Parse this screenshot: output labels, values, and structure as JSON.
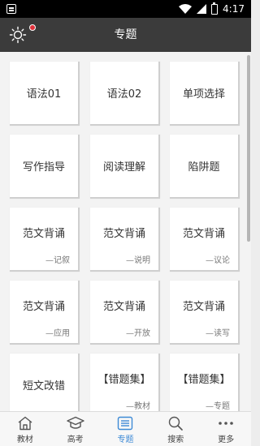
{
  "status_bar": {
    "time": "4:17"
  },
  "app_bar": {
    "title": "专题"
  },
  "cards": [
    {
      "label": "语法01",
      "sub": ""
    },
    {
      "label": "语法02",
      "sub": ""
    },
    {
      "label": "单项选择",
      "sub": ""
    },
    {
      "label": "写作指导",
      "sub": ""
    },
    {
      "label": "阅读理解",
      "sub": ""
    },
    {
      "label": "陷阱题",
      "sub": ""
    },
    {
      "label": "范文背诵",
      "sub": "—记叙"
    },
    {
      "label": "范文背诵",
      "sub": "—说明"
    },
    {
      "label": "范文背诵",
      "sub": "—议论"
    },
    {
      "label": "范文背诵",
      "sub": "—应用"
    },
    {
      "label": "范文背诵",
      "sub": "—开放"
    },
    {
      "label": "范文背诵",
      "sub": "—读写"
    },
    {
      "label": "短文改错",
      "sub": ""
    },
    {
      "label": "【错题集】",
      "sub": "—教材"
    },
    {
      "label": "【错题集】",
      "sub": "—专题"
    }
  ],
  "tabs": [
    {
      "label": "教材",
      "icon": "home-icon",
      "active": false
    },
    {
      "label": "高考",
      "icon": "graduation-cap-icon",
      "active": false
    },
    {
      "label": "专题",
      "icon": "list-icon",
      "active": true
    },
    {
      "label": "搜索",
      "icon": "search-icon",
      "active": false
    },
    {
      "label": "更多",
      "icon": "more-dots-icon",
      "active": false
    }
  ],
  "colors": {
    "app_bar": "#3b3b3b",
    "active_tab": "#3d8ad6",
    "badge": "#e0303a"
  }
}
